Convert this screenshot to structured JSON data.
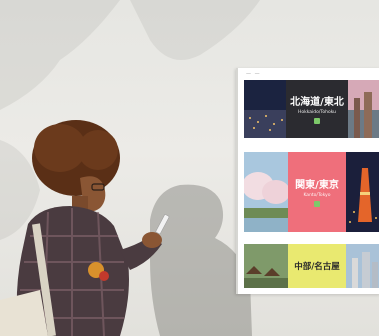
{
  "scene": {
    "description_alt": "Person with smartphone in front of travel poster"
  },
  "poster": {
    "header_text": "— —",
    "cards": [
      {
        "top": "",
        "jp": "北海道/東北",
        "en": "Hokkaido/Tohoku"
      },
      {
        "top": "",
        "jp": "関東/東京",
        "en": "Kanto/Tokyo"
      },
      {
        "top": "",
        "jp": "中部/名古屋",
        "en": ""
      }
    ]
  },
  "colors": {
    "wall": "#e6e6e2",
    "card1_label": "#2b2b30",
    "card2_label": "#ef6f7b",
    "card3_label": "#e9e970"
  }
}
